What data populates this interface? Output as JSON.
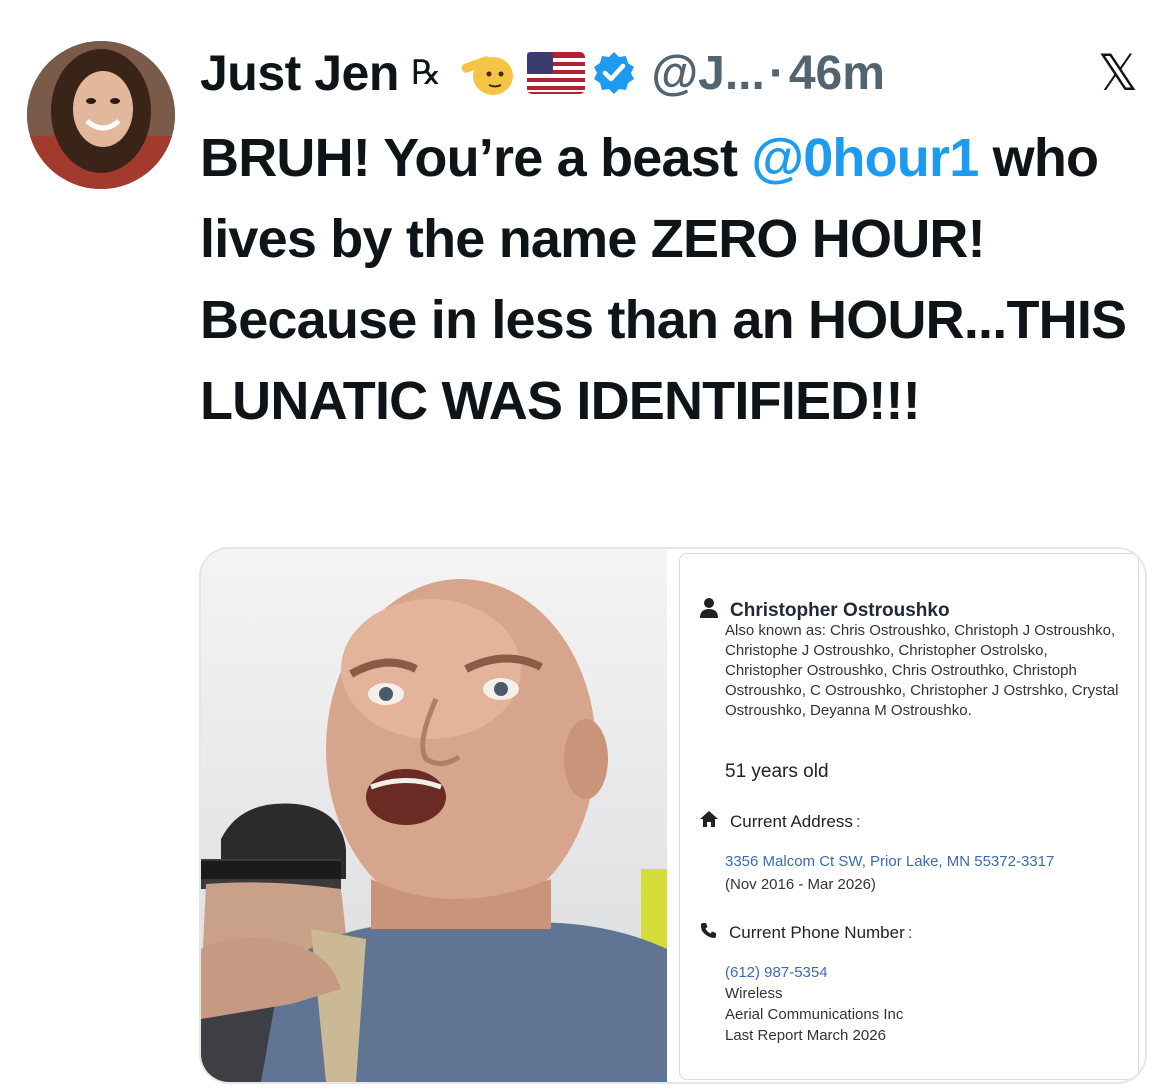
{
  "author": {
    "display_name": "Just Jen",
    "rx_badge": "℞",
    "emoji_names": [
      "saluting-face-emoji",
      "us-flag-emoji"
    ],
    "handle": "@J...",
    "separator": "·",
    "time": "46m",
    "x_logo": "𝕏"
  },
  "tweet": {
    "text_before": "BRUH! You’re a beast ",
    "mention": "@0hour1",
    "text_after": " who lives by the name ZERO HOUR! Because in less than an HOUR...THIS LUNATIC WAS IDENTIFIED!!!"
  },
  "record_card": {
    "name": "Christopher Ostroushko",
    "also_known_as": "Also known as: Chris Ostroushko, Christoph J Ostroushko, Christophe J Ostroushko, Christopher Ostrolsko, Christopher Ostroushko, Chris Ostrouthko, Christoph Ostroushko, C Ostroushko, Christopher J Ostrshko, Crystal Ostroushko, Deyanna M Ostroushko.",
    "age": "51 years old",
    "address_label": "Current Address",
    "address": "3356 Malcom Ct SW, Prior Lake, MN 55372-3317",
    "address_dates": "(Nov 2016 - Mar 2026)",
    "phone_label": "Current Phone Number",
    "phone": "(612) 987-5354",
    "phone_type": "Wireless",
    "carrier": "Aerial Communications Inc",
    "last_report": "Last Report March 2026"
  },
  "colors": {
    "link": "#1d9bf0",
    "verified": "#1d9bf0",
    "muted": "#536471",
    "card_link": "#3b6bb4"
  }
}
